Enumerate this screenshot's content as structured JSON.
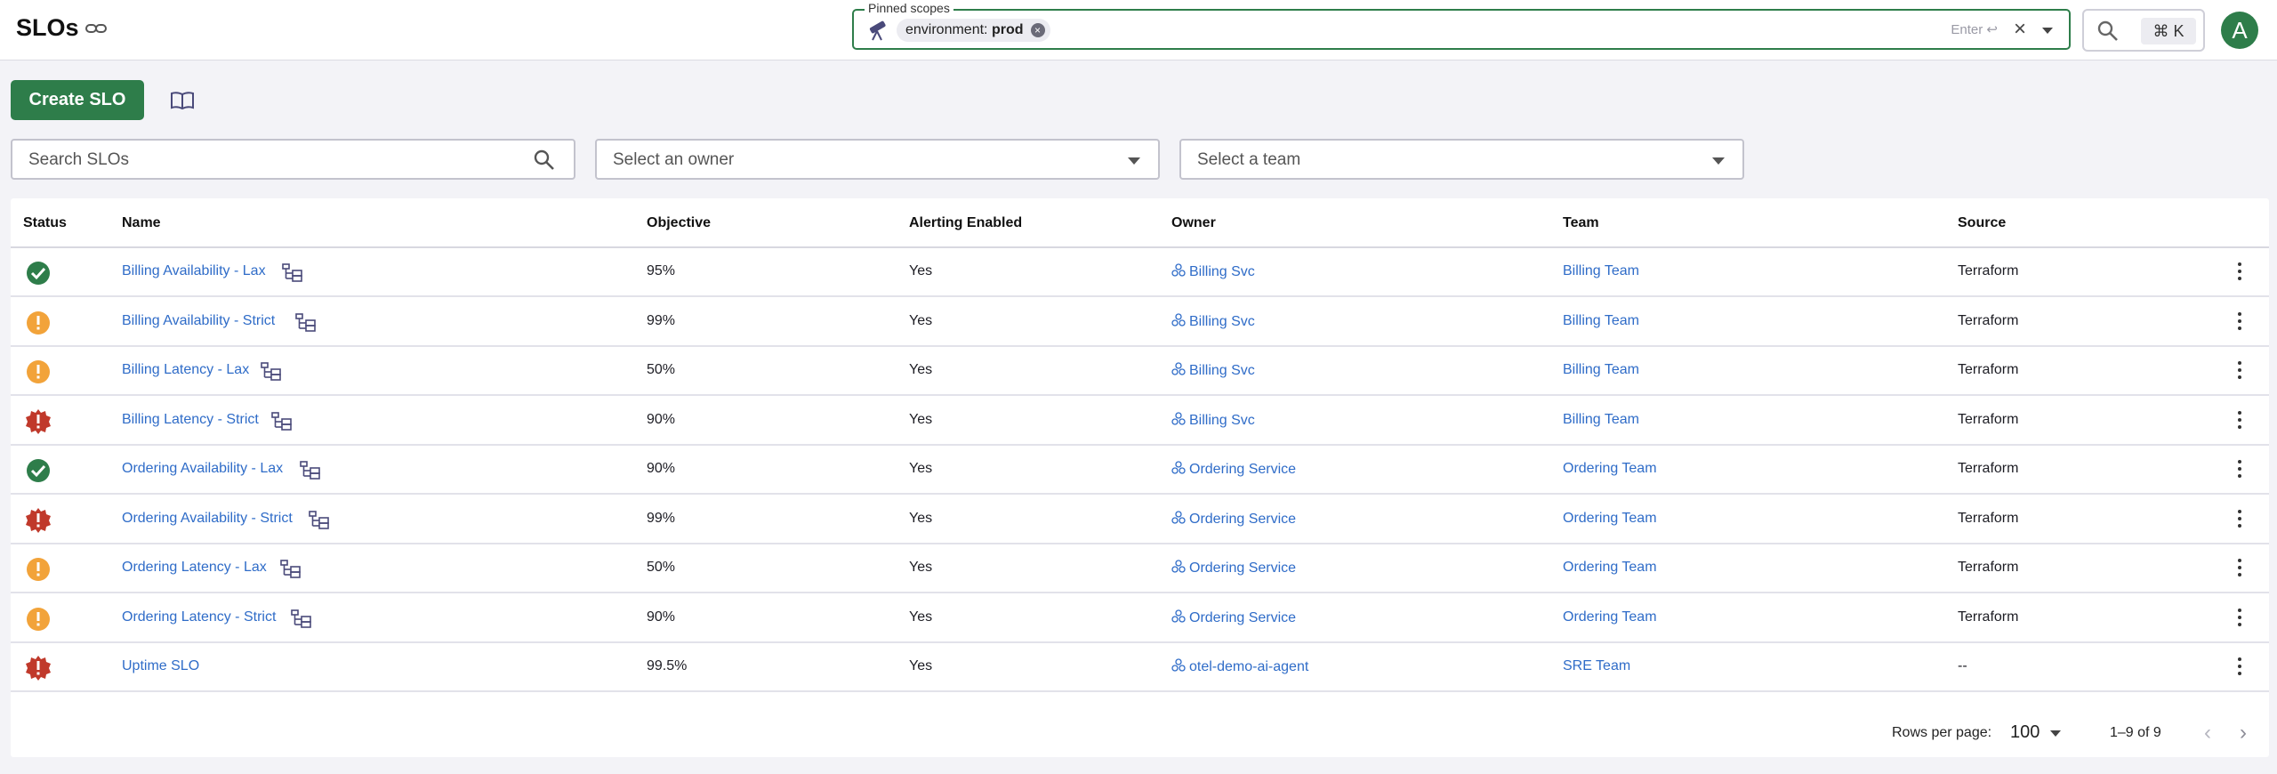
{
  "header": {
    "title": "SLOs",
    "pinned_label": "Pinned scopes",
    "scope_key": "environment:",
    "scope_value": "prod",
    "enter_hint": "Enter ↩",
    "shortcut": "⌘ K",
    "avatar_initial": "A"
  },
  "toolbar": {
    "create_label": "Create SLO"
  },
  "filters": {
    "search_placeholder": "Search SLOs",
    "owner_placeholder": "Select an owner",
    "team_placeholder": "Select a team"
  },
  "table": {
    "columns": [
      "Status",
      "Name",
      "Objective",
      "Alerting Enabled",
      "Owner",
      "Team",
      "Source"
    ],
    "rows": [
      {
        "status": "ok",
        "name": "Billing Availability - Lax",
        "objective": "95%",
        "alerting": "Yes",
        "owner": "Billing Svc",
        "team": "Billing Team",
        "source": "Terraform"
      },
      {
        "status": "warning",
        "name": "Billing Availability - Strict",
        "objective": "99%",
        "alerting": "Yes",
        "owner": "Billing Svc",
        "team": "Billing Team",
        "source": "Terraform"
      },
      {
        "status": "warning",
        "name": "Billing Latency - Lax",
        "objective": "50%",
        "alerting": "Yes",
        "owner": "Billing Svc",
        "team": "Billing Team",
        "source": "Terraform"
      },
      {
        "status": "critical",
        "name": "Billing Latency - Strict",
        "objective": "90%",
        "alerting": "Yes",
        "owner": "Billing Svc",
        "team": "Billing Team",
        "source": "Terraform"
      },
      {
        "status": "ok",
        "name": "Ordering Availability - Lax",
        "objective": "90%",
        "alerting": "Yes",
        "owner": "Ordering Service",
        "team": "Ordering Team",
        "source": "Terraform"
      },
      {
        "status": "critical",
        "name": "Ordering Availability - Strict",
        "objective": "99%",
        "alerting": "Yes",
        "owner": "Ordering Service",
        "team": "Ordering Team",
        "source": "Terraform"
      },
      {
        "status": "warning",
        "name": "Ordering Latency - Lax",
        "objective": "50%",
        "alerting": "Yes",
        "owner": "Ordering Service",
        "team": "Ordering Team",
        "source": "Terraform"
      },
      {
        "status": "warning",
        "name": "Ordering Latency - Strict",
        "objective": "90%",
        "alerting": "Yes",
        "owner": "Ordering Service",
        "team": "Ordering Team",
        "source": "Terraform"
      },
      {
        "status": "critical",
        "name": "Uptime SLO",
        "objective": "99.5%",
        "alerting": "Yes",
        "owner": "otel-demo-ai-agent",
        "team": "SRE Team",
        "source": "--"
      }
    ]
  },
  "pagination": {
    "rows_per_page_label": "Rows per page:",
    "rows_per_page": "100",
    "range": "1–9 of 9"
  },
  "colors": {
    "primary_green": "#2e7d4a",
    "status_ok": "#2e7d4a",
    "status_warning": "#f2a33a",
    "status_critical": "#c0392b",
    "link": "#2f6cc8"
  }
}
